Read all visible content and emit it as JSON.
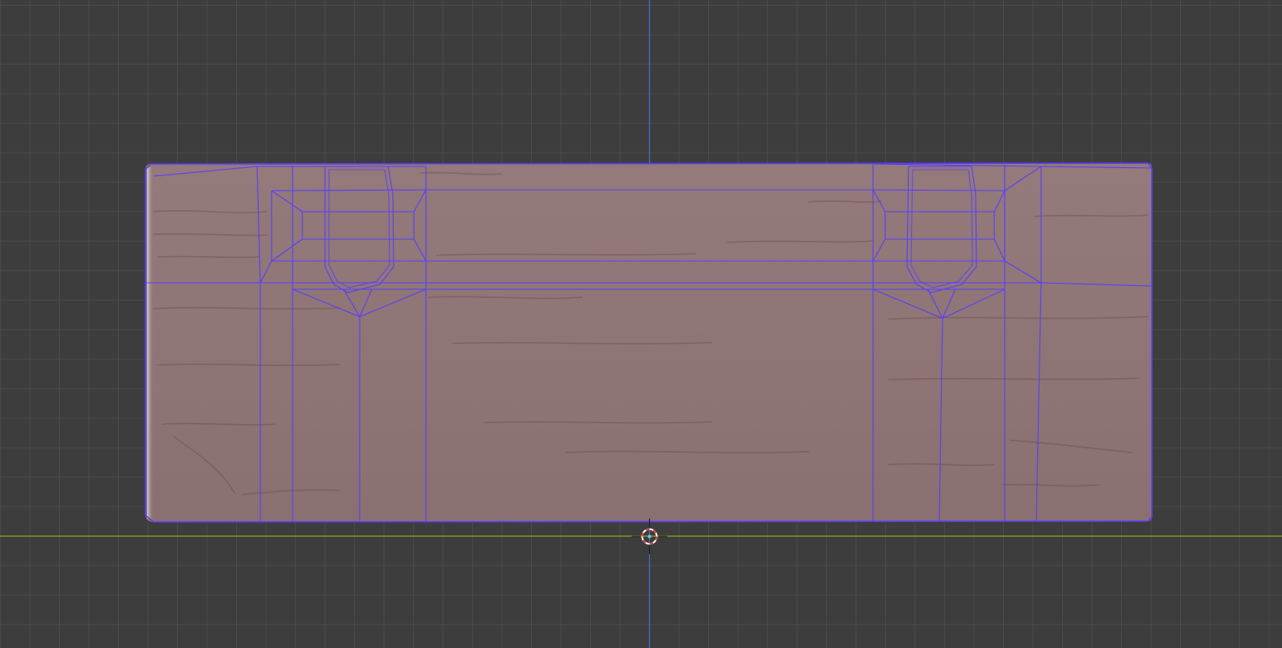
{
  "viewport": {
    "view": "front-orthographic",
    "background_color": "#3d3d3d",
    "grid_color": "#4b4b4b",
    "grid_major_color": "#545454",
    "x_axis_color": "#8aa631",
    "z_axis_color": "#3f74c9"
  },
  "mesh": {
    "material_color": "#8f7474",
    "wire_color": "#5a3cff",
    "edge_highlight_color": "#bfbfbf",
    "groove_color": "#6e4a4a"
  },
  "cursor_3d": {
    "icon": "3d-cursor-icon",
    "ring_color_a": "#e04040",
    "ring_color_b": "#ffffff"
  }
}
